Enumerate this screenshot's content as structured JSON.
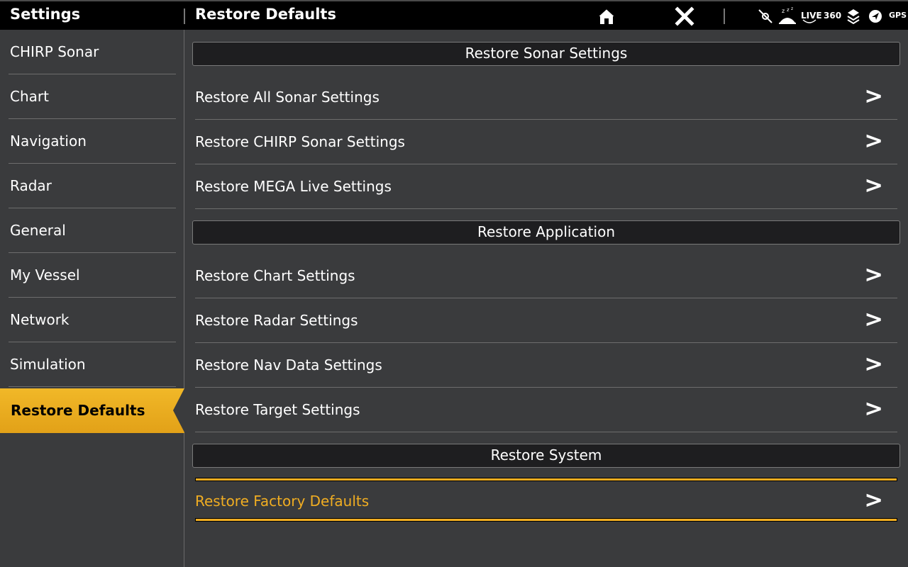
{
  "header": {
    "app_title": "Settings",
    "page_title": "Restore Defaults",
    "status": {
      "live_label": "LIVE",
      "three_sixty_label": "360",
      "gps_label": "GPS"
    }
  },
  "sidebar": {
    "items": [
      {
        "label": "CHIRP Sonar"
      },
      {
        "label": "Chart"
      },
      {
        "label": "Navigation"
      },
      {
        "label": "Radar"
      },
      {
        "label": "General"
      },
      {
        "label": "My Vessel"
      },
      {
        "label": "Network"
      },
      {
        "label": "Simulation"
      },
      {
        "label": "Restore Defaults"
      }
    ],
    "active_index": 8
  },
  "main": {
    "sections": [
      {
        "header": "Restore Sonar Settings",
        "items": [
          {
            "label": "Restore All Sonar Settings"
          },
          {
            "label": "Restore CHIRP Sonar Settings"
          },
          {
            "label": "Restore MEGA Live Settings"
          }
        ]
      },
      {
        "header": "Restore Application",
        "items": [
          {
            "label": "Restore Chart Settings"
          },
          {
            "label": "Restore Radar Settings"
          },
          {
            "label": "Restore Nav Data Settings"
          },
          {
            "label": "Restore Target Settings"
          }
        ]
      },
      {
        "header": "Restore System",
        "items": [
          {
            "label": "Restore Factory Defaults"
          }
        ]
      }
    ],
    "chevron": ">"
  },
  "colors": {
    "accent": "#f0ad22",
    "background": "#3a3b3d",
    "topbar": "#000000"
  }
}
